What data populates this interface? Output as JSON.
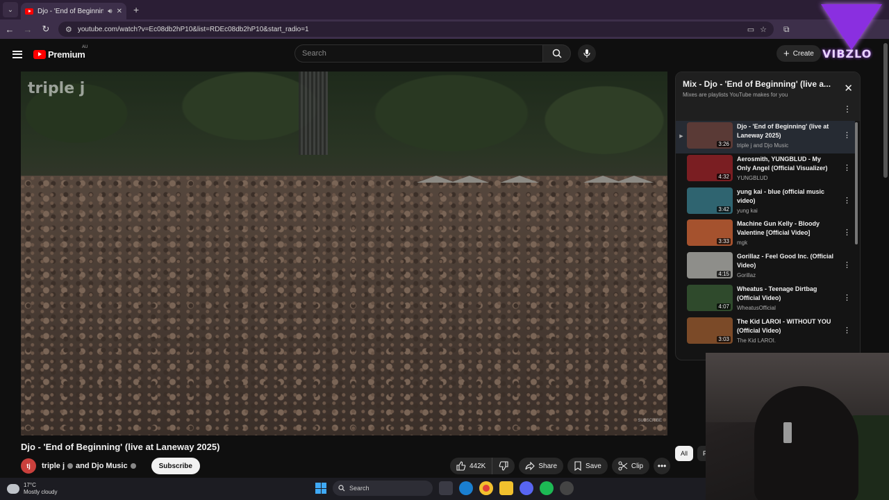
{
  "browser": {
    "tab_title": "Djo - 'End of Beginning' (live",
    "url": "youtube.com/watch?v=Ec08db2hP10&list=RDEc08db2hP10&start_radio=1"
  },
  "masthead": {
    "logo_text": "Premium",
    "logo_region": "AU",
    "search_placeholder": "Search",
    "create_label": "Create"
  },
  "player": {
    "watermark": "triple j",
    "subscribe_watermark": "SUBSCRIBE"
  },
  "video": {
    "title": "Djo - 'End of Beginning' (live at Laneway 2025)",
    "channel_name": "triple j",
    "channel_and": "and Djo Music",
    "subscribe_label": "Subscribe",
    "likes": "442K",
    "share_label": "Share",
    "save_label": "Save",
    "clip_label": "Clip"
  },
  "playlist": {
    "title": "Mix - Djo - 'End of Beginning' (live a...",
    "subtitle": "Mixes are playlists YouTube makes for you",
    "items": [
      {
        "idx": "▶",
        "title": "Djo - 'End of Beginning' (live at Laneway 2025)",
        "channel": "triple j and Djo Music",
        "duration": "3:26",
        "thumb": "#5a3a36"
      },
      {
        "idx": "",
        "title": "Aerosmith, YUNGBLUD - My Only Angel (Official Visualizer)",
        "channel": "YUNGBLUD",
        "duration": "4:32",
        "thumb": "#7a1e22"
      },
      {
        "idx": "",
        "title": "yung kai - blue (official music video)",
        "channel": "yung kai",
        "duration": "3:42",
        "thumb": "#2f6470"
      },
      {
        "idx": "",
        "title": "Machine Gun Kelly - Bloody Valentine [Official Video]",
        "channel": "mgk",
        "duration": "3:33",
        "thumb": "#a5522e"
      },
      {
        "idx": "",
        "title": "Gorillaz - Feel Good Inc. (Official Video)",
        "channel": "Gorillaz",
        "duration": "4:15",
        "thumb": "#8e8e8a"
      },
      {
        "idx": "",
        "title": "Wheatus - Teenage Dirtbag (Official Video)",
        "channel": "WheatusOfficial",
        "duration": "4:07",
        "thumb": "#2f4a2c"
      },
      {
        "idx": "",
        "title": "The Kid LAROI - WITHOUT YOU (Official Video)",
        "channel": "The Kid LAROI.",
        "duration": "3:03",
        "thumb": "#7b4a28"
      }
    ]
  },
  "chips": {
    "all": "All",
    "next": "F"
  },
  "overlay": {
    "brand": "VIBZLO"
  },
  "taskbar": {
    "temp": "17°C",
    "weather": "Mostly cloudy",
    "search_label": "Search"
  }
}
